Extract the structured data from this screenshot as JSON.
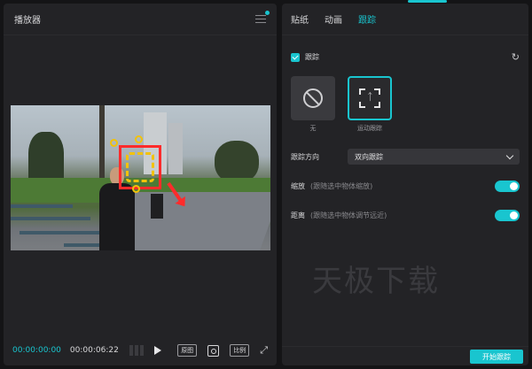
{
  "player": {
    "title": "播放器",
    "time_current": "00:00:00:00",
    "time_total": "00:00:06:22",
    "btn_original": "原图",
    "btn_ratio": "比例"
  },
  "side": {
    "tabs": [
      {
        "label": "贴纸"
      },
      {
        "label": "动画"
      },
      {
        "label": "跟踪"
      }
    ],
    "tracking_label": "跟踪",
    "options": [
      {
        "label": "无"
      },
      {
        "label": "运动跟踪"
      }
    ],
    "direction": {
      "label": "跟踪方向",
      "value": "双向跟踪"
    },
    "scale": {
      "label": "缩放",
      "hint": "(跟随选中物体缩放)"
    },
    "distance": {
      "label": "距离",
      "hint": "(跟随选中物体调节远近)"
    },
    "watermark": "天极下载",
    "start_button": "开始跟踪"
  },
  "colors": {
    "accent": "#19c5cf",
    "highlight": "#ff2b2b",
    "handle": "#f2c20a"
  }
}
